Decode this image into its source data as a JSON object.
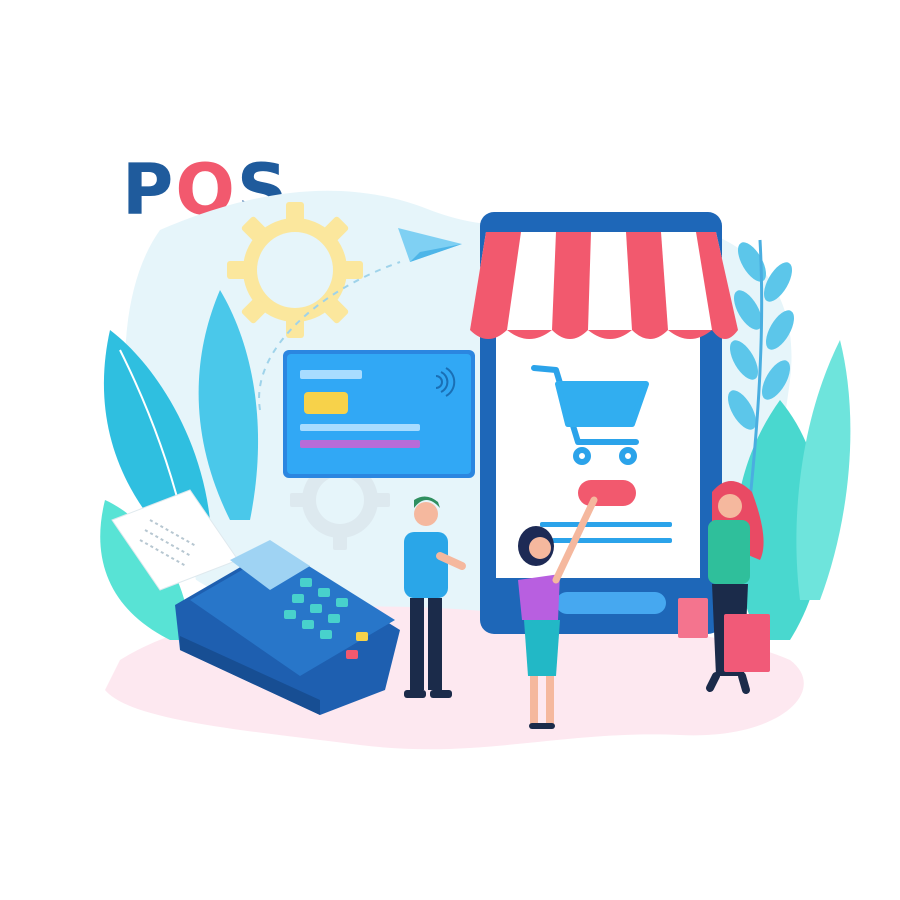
{
  "heading": {
    "letters": [
      "P",
      "O",
      "S"
    ]
  },
  "colors": {
    "navy": "#1f5b9c",
    "coral": "#f2596e",
    "sky": "#dcf0f8",
    "teal": "#49d8cf",
    "blue": "#2da4ef",
    "gear": "#fbe79d",
    "pink_ground": "#fde8f0"
  },
  "icons": {
    "gear": "gear-icon",
    "paper_plane": "paper-plane-icon",
    "contactless": "contactless-icon",
    "cart": "shopping-cart-icon"
  }
}
